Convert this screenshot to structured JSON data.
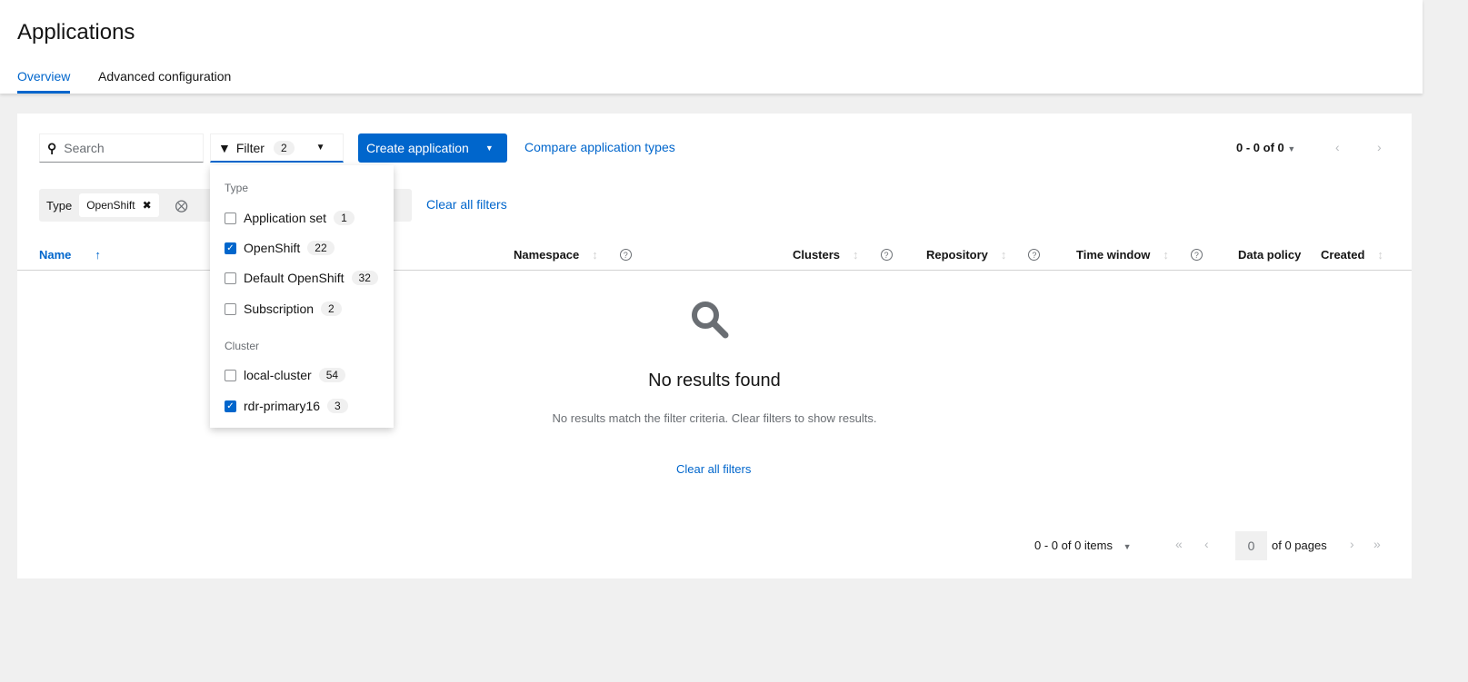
{
  "header": {
    "title": "Applications",
    "tabs": [
      {
        "label": "Overview"
      },
      {
        "label": "Advanced configuration"
      }
    ]
  },
  "toolbar": {
    "search_placeholder": "Search",
    "filter_label": "Filter",
    "filter_count": "2",
    "create_label": "Create application",
    "compare_link": "Compare application types",
    "pagination": "0 - 0 of 0"
  },
  "chips": {
    "category": "Type",
    "value": "OpenShift",
    "clear_all": "Clear all filters"
  },
  "columns": [
    "Name",
    "Namespace",
    "Clusters",
    "Repository",
    "Time window",
    "Data policy",
    "Created"
  ],
  "filter_menu": {
    "groups": [
      {
        "label": "Type",
        "options": [
          {
            "label": "Application set",
            "count": "1",
            "checked": false
          },
          {
            "label": "OpenShift",
            "count": "22",
            "checked": true
          },
          {
            "label": "Default OpenShift",
            "count": "32",
            "checked": false
          },
          {
            "label": "Subscription",
            "count": "2",
            "checked": false
          }
        ]
      },
      {
        "label": "Cluster",
        "options": [
          {
            "label": "local-cluster",
            "count": "54",
            "checked": false
          },
          {
            "label": "rdr-primary16",
            "count": "3",
            "checked": true
          }
        ]
      }
    ]
  },
  "empty": {
    "title": "No results found",
    "body": "No results match the filter criteria. Clear filters to show results.",
    "link": "Clear all filters"
  },
  "footer": {
    "items": "0 - 0 of 0 items",
    "page": "0",
    "pages": "of 0 pages"
  }
}
